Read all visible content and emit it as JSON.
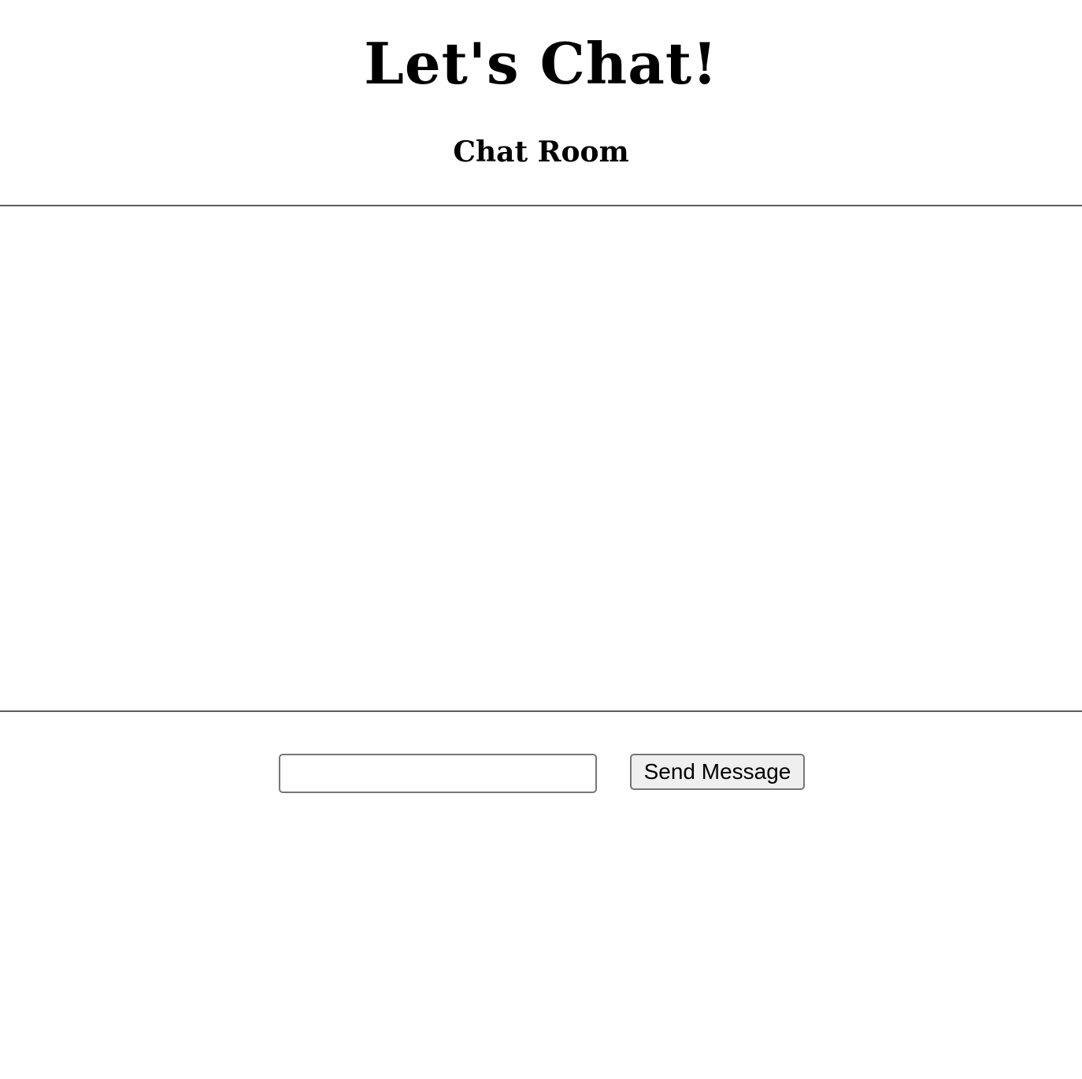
{
  "header": {
    "title": "Let's Chat!",
    "room_title": "Chat Room"
  },
  "composer": {
    "input_value": "",
    "send_label": "Send Message"
  }
}
